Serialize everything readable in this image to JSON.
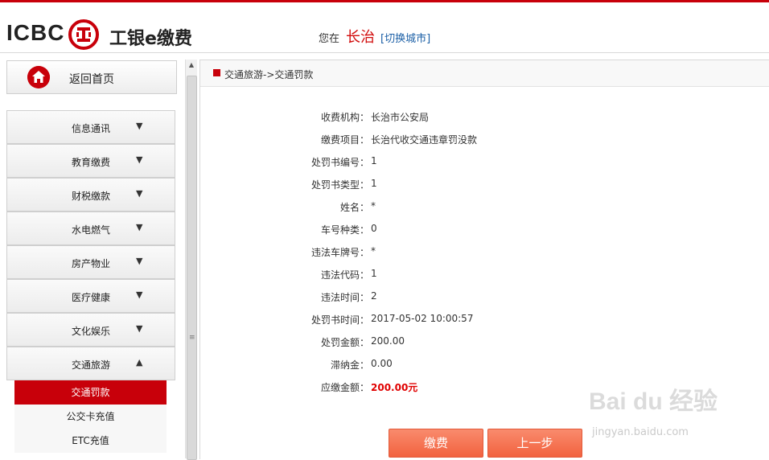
{
  "header": {
    "bank_logo_text": "ICBC",
    "logo_icon": "icbc-seal-icon",
    "brand_name": "工银e缴费",
    "city_prefix": "您在",
    "city_name": "长治",
    "switch_city_label": "[切换城市]"
  },
  "sidebar": {
    "home_label": "返回首页",
    "home_icon": "home-icon",
    "menu": [
      {
        "label": "信息通讯",
        "arrow": "▼"
      },
      {
        "label": "教育缴费",
        "arrow": "▼"
      },
      {
        "label": "财税缴款",
        "arrow": "▼"
      },
      {
        "label": "水电燃气",
        "arrow": "▼"
      },
      {
        "label": "房产物业",
        "arrow": "▼"
      },
      {
        "label": "医疗健康",
        "arrow": "▼"
      },
      {
        "label": "文化娱乐",
        "arrow": "▼"
      },
      {
        "label": "交通旅游",
        "arrow": "▲"
      }
    ],
    "submenu": [
      {
        "label": "交通罚款",
        "active": true
      },
      {
        "label": "公交卡充值",
        "active": false
      },
      {
        "label": "ETC充值",
        "active": false
      }
    ]
  },
  "breadcrumb": "交通旅游->交通罚款",
  "details": [
    {
      "label": "收费机构：",
      "value": "长治市公安局"
    },
    {
      "label": "缴费项目：",
      "value": "长治代收交通违章罚没款"
    },
    {
      "label": "处罚书编号：",
      "value": "1"
    },
    {
      "label": "处罚书类型：",
      "value": "1"
    },
    {
      "label": "姓名：",
      "value": "*"
    },
    {
      "label": "车号种类：",
      "value": "0"
    },
    {
      "label": "违法车牌号：",
      "value": "*"
    },
    {
      "label": "违法代码：",
      "value": "1"
    },
    {
      "label": "违法时间：",
      "value": "2"
    },
    {
      "label": "处罚书时间：",
      "value": "2017-05-02 10:00:57"
    },
    {
      "label": "处罚金额：",
      "value": "200.00"
    },
    {
      "label": "滞纳金：",
      "value": "0.00"
    },
    {
      "label": "应缴金额：",
      "value": "200.00元"
    }
  ],
  "buttons": {
    "pay": "缴费",
    "back": "上一步"
  },
  "watermark": {
    "main": "Bai du 经验",
    "sub": "jingyan.baidu.com"
  },
  "colors": {
    "brand_red": "#c8000a",
    "button_orange": "#f2623f",
    "amount_red": "#e00000",
    "link_blue": "#1b5fa6"
  }
}
